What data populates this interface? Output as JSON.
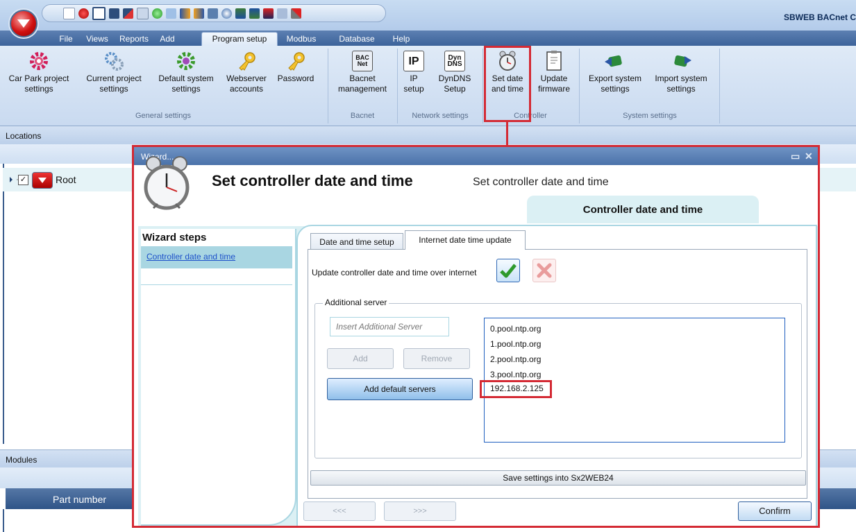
{
  "app": {
    "title": "SBWEB BACnet C"
  },
  "colors": {
    "ribbon_tab_bg": "#3c639a",
    "highlight_red": "#d42a34",
    "step_selected": "#a9d6e2",
    "link": "#1b4fc9"
  },
  "quick_access_icons": [
    "new-icon",
    "record-icon",
    "open-icon",
    "save-icon",
    "save-as-icon",
    "edit-icon",
    "refresh-icon",
    "copy-icon",
    "forward-icon",
    "back-icon",
    "network-icon",
    "antenna-icon",
    "tree-icon",
    "tree-icon",
    "flag-icon",
    "list-icon",
    "tools-icon"
  ],
  "menu": {
    "tabs": [
      "File",
      "Views",
      "Reports",
      "Add",
      "Program setup",
      "Modbus",
      "Database",
      "Help"
    ],
    "active": "Program setup"
  },
  "ribbon": {
    "general": {
      "label": "General settings",
      "buttons": [
        {
          "line1": "Car Park project",
          "line2": "settings",
          "icon": "gear-icon"
        },
        {
          "line1": "Current project",
          "line2": "settings",
          "icon": "gears-icon"
        },
        {
          "line1": "Default system",
          "line2": "settings",
          "icon": "gear-icon"
        },
        {
          "line1": "Webserver",
          "line2": "accounts",
          "icon": "key-icon"
        },
        {
          "line1": "Password",
          "line2": "",
          "icon": "key-icon"
        }
      ]
    },
    "bacnet": {
      "label": "Bacnet",
      "buttons": [
        {
          "line1": "Bacnet",
          "line2": "management",
          "icon": "bacnet-icon",
          "tile": "BAC Net"
        }
      ]
    },
    "network": {
      "label": "Network settings",
      "buttons": [
        {
          "line1": "IP",
          "line2": "setup",
          "icon": "ip-icon",
          "tile": "IP"
        },
        {
          "line1": "DynDNS",
          "line2": "Setup",
          "icon": "dyndns-icon",
          "tile": "Dyn DNS"
        }
      ]
    },
    "controller": {
      "label": "Controller",
      "buttons": [
        {
          "line1": "Set date",
          "line2": "and time",
          "icon": "alarm-clock-icon"
        },
        {
          "line1": "Update",
          "line2": "firmware",
          "icon": "document-icon"
        }
      ]
    },
    "system": {
      "label": "System settings",
      "buttons": [
        {
          "line1": "Export system",
          "line2": "settings",
          "icon": "export-icon"
        },
        {
          "line1": "Import system",
          "line2": "settings",
          "icon": "import-icon"
        }
      ]
    }
  },
  "panes": {
    "locations": "Locations",
    "tree_root": {
      "label": "Root",
      "checked": true
    },
    "modules": "Modules",
    "grid_header": "Part number"
  },
  "wizard": {
    "window_title": "Wizard...",
    "title": "Set controller date and time",
    "subtitle": "Set controller date and time",
    "section_tab": "Controller date and time",
    "steps_title": "Wizard steps",
    "steps": [
      "Controller date and time"
    ],
    "tabs": [
      "Date and time setup",
      "Internet date time update"
    ],
    "active_tab": "Internet date time update",
    "update_label": "Update controller date and time over internet",
    "update_enabled": true,
    "additional_server_legend": "Additional server",
    "server_input_placeholder": "Insert Additional Server",
    "add_button": "Add",
    "remove_button": "Remove",
    "add_default_button": "Add default servers",
    "servers": [
      "0.pool.ntp.org",
      "1.pool.ntp.org",
      "2.pool.ntp.org",
      "3.pool.ntp.org",
      "192.168.2.125"
    ],
    "save_button": "Save settings into Sx2WEB24",
    "prev_button": "<<<",
    "next_button": ">>>",
    "confirm_button": "Confirm"
  }
}
